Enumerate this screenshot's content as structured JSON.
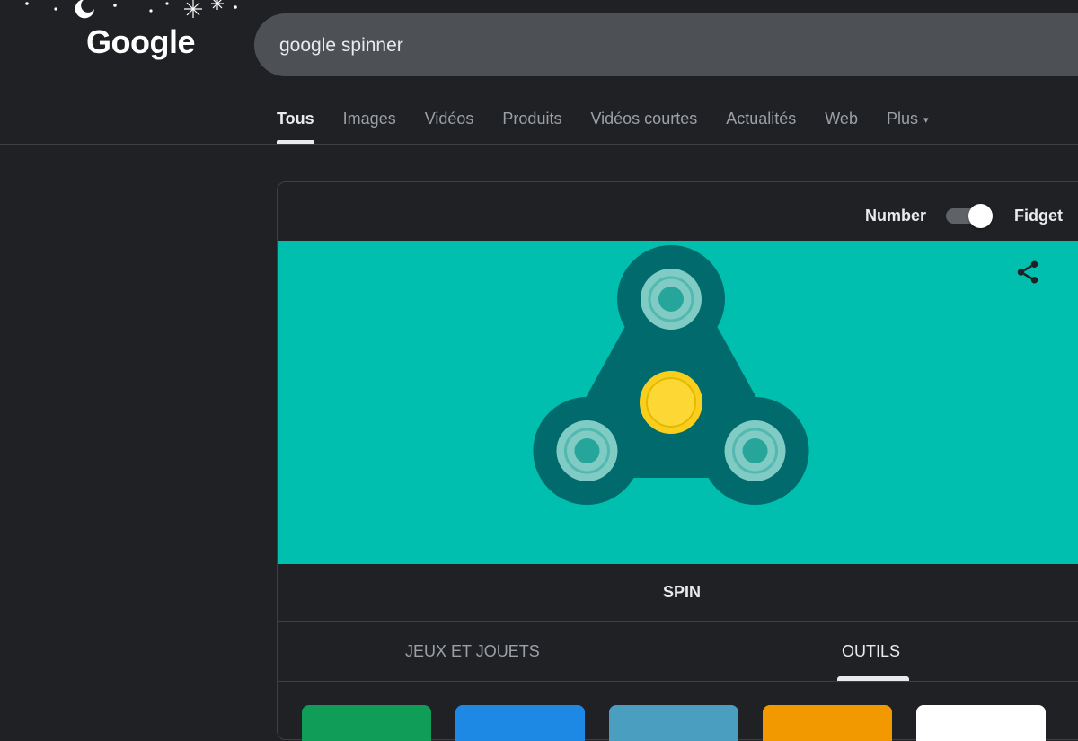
{
  "header": {
    "logo_text": "Google",
    "search_value": "google spinner"
  },
  "tabs": [
    {
      "label": "Tous",
      "active": true
    },
    {
      "label": "Images"
    },
    {
      "label": "Vidéos"
    },
    {
      "label": "Produits"
    },
    {
      "label": "Vidéos courtes"
    },
    {
      "label": "Actualités"
    },
    {
      "label": "Web"
    },
    {
      "label": "Plus",
      "has_caret": true
    }
  ],
  "widget": {
    "toggle": {
      "left_label": "Number",
      "right_label": "Fidget",
      "selected": "Fidget"
    },
    "spin_label": "SPIN",
    "categories": [
      {
        "label": "JEUX ET JOUETS"
      },
      {
        "label": "OUTILS",
        "active": true
      }
    ],
    "colors": {
      "background": "#00bfae",
      "body": "#006a6d",
      "bearing_outer": "#80cbc4",
      "bearing_inner": "#26a69a",
      "center_outer": "#f9ce1d",
      "center_inner": "#fdd835"
    },
    "tile_colors": [
      "#0f9d58",
      "#1e88e5",
      "#4a9fc0",
      "#f29900",
      "#ffffff"
    ]
  }
}
